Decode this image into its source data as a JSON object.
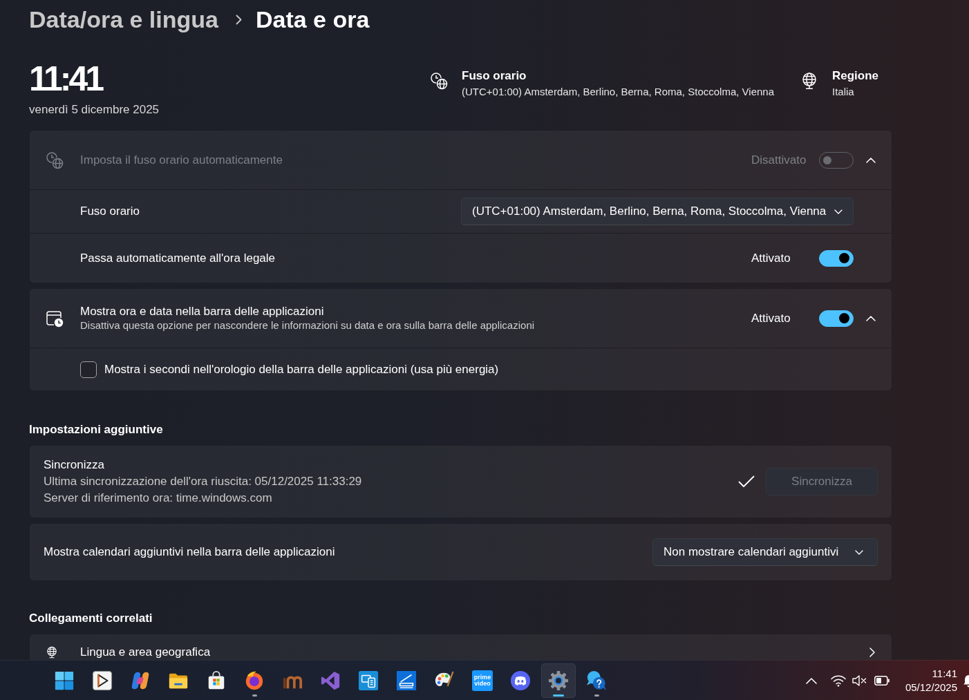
{
  "breadcrumb": [
    {
      "label": "Data/ora e lingua",
      "current": false
    },
    {
      "label": "Data e ora",
      "current": true
    }
  ],
  "clock": {
    "time": "11:41",
    "date": "venerdì 5 dicembre 2025"
  },
  "info": [
    {
      "kind": "timezone",
      "title": "Fuso orario",
      "value": "(UTC+01:00) Amsterdam, Berlino, Berna, Roma, Stoccolma, Vienna"
    },
    {
      "kind": "region",
      "title": "Regione",
      "value": "Italia"
    }
  ],
  "expanders": [
    {
      "kind": "timezone",
      "label": "Imposta il fuso orario automaticamente",
      "disabled": true,
      "status": "Disattivato",
      "on": false,
      "expanded": true,
      "rows": [
        {
          "kind": "dropdown",
          "label": "Fuso orario",
          "value": "(UTC+01:00) Amsterdam, Berlino, Berna, Roma, Stoccolma, Vienna"
        },
        {
          "kind": "toggle",
          "label": "Passa automaticamente all'ora legale",
          "status": "Attivato",
          "on": true
        }
      ]
    },
    {
      "kind": "clock",
      "label": "Mostra ora e data nella barra delle applicazioni",
      "description": "Disattiva questa opzione per nascondere le informazioni su data e ora sulla barra delle applicazioni",
      "disabled": false,
      "status": "Attivato",
      "on": true,
      "expanded": true,
      "rows": [
        {
          "kind": "checkbox",
          "label": "Mostra i secondi nell'orologio della barra delle applicazioni (usa più energia)",
          "checked": false
        }
      ]
    }
  ],
  "additional": {
    "title": "Impostazioni aggiuntive",
    "cards": [
      {
        "kind": "sync",
        "title": "Sincronizza",
        "lines": [
          "Ultima sincronizzazione dell'ora riuscita: 05/12/2025 11:33:29",
          "Server di riferimento ora: time.windows.com"
        ],
        "synced": true,
        "button": {
          "label": "Sincronizza",
          "disabled": true
        }
      },
      {
        "kind": "dropdown",
        "label": "Mostra calendari aggiuntivi nella barra delle applicazioni",
        "value": "Non mostrare calendari aggiuntivi"
      }
    ]
  },
  "related": {
    "title": "Collegamenti correlati",
    "links": [
      {
        "label": "Lingua e area geografica"
      }
    ]
  },
  "taskbar": {
    "apps": [
      {
        "kind": "start",
        "running": false,
        "active": false
      },
      {
        "kind": "player",
        "running": false,
        "active": false
      },
      {
        "kind": "swirl",
        "running": false,
        "active": false
      },
      {
        "kind": "folder",
        "running": false,
        "active": false
      },
      {
        "kind": "store",
        "running": false,
        "active": false
      },
      {
        "kind": "browser",
        "running": true,
        "active": false
      },
      {
        "kind": "arches",
        "running": false,
        "active": false
      },
      {
        "kind": "ribbon",
        "running": false,
        "active": false
      },
      {
        "kind": "devices",
        "running": false,
        "active": false
      },
      {
        "kind": "scanner",
        "running": false,
        "active": false
      },
      {
        "kind": "palette",
        "running": false,
        "active": false
      },
      {
        "kind": "video",
        "label": "prime video",
        "running": false,
        "active": false
      },
      {
        "kind": "chat",
        "running": false,
        "active": false
      },
      {
        "kind": "settings",
        "running": true,
        "active": true
      },
      {
        "kind": "help",
        "running": true,
        "active": false
      }
    ],
    "tray": {
      "time": "11:41",
      "date": "05/12/2025"
    }
  }
}
